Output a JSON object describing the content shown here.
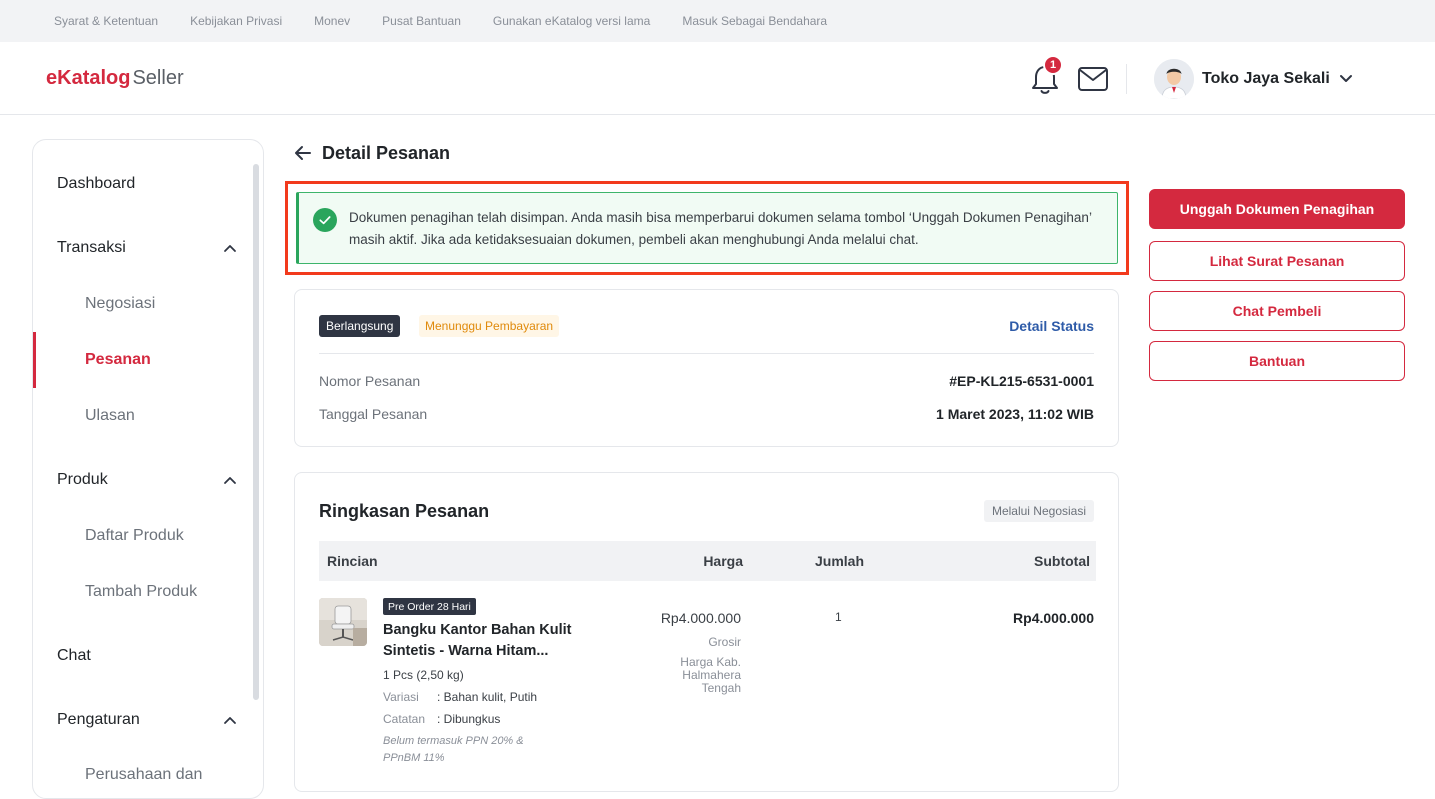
{
  "topbar": {
    "links": [
      "Syarat & Ketentuan",
      "Kebijakan Privasi",
      "Monev",
      "Pusat Bantuan",
      "Gunakan eKatalog versi lama",
      "Masuk Sebagai Bendahara"
    ]
  },
  "header": {
    "logo_main": "eKatalog",
    "logo_sub": "Seller",
    "notification_count": "1",
    "user_name": "Toko Jaya Sekali"
  },
  "sidebar": {
    "dashboard": "Dashboard",
    "transaksi": "Transaksi",
    "negosiasi": "Negosiasi",
    "pesanan": "Pesanan",
    "ulasan": "Ulasan",
    "produk": "Produk",
    "daftar_produk": "Daftar Produk",
    "tambah_produk": "Tambah Produk",
    "chat": "Chat",
    "pengaturan": "Pengaturan",
    "perusahaan": "Perusahaan dan"
  },
  "page": {
    "title": "Detail Pesanan"
  },
  "alert": {
    "text": "Dokumen penagihan telah disimpan. Anda masih bisa memperbarui dokumen selama tombol ‘Unggah Dokumen Penagihan’ masih aktif. Jika ada ketidaksesuaian dokumen, pembeli akan menghubungi Anda melalui chat."
  },
  "order": {
    "status_tag": "Berlangsung",
    "payment_tag": "Menunggu Pembayaran",
    "detail_status_link": "Detail Status",
    "number_label": "Nomor Pesanan",
    "number_value": "#EP-KL215-6531-0001",
    "date_label": "Tanggal Pesanan",
    "date_value": "1 Maret 2023, 11:02 WIB"
  },
  "summary": {
    "title": "Ringkasan Pesanan",
    "via_tag": "Melalui Negosiasi",
    "columns": {
      "rincian": "Rincian",
      "harga": "Harga",
      "jumlah": "Jumlah",
      "subtotal": "Subtotal"
    },
    "item": {
      "preorder_tag": "Pre Order 28 Hari",
      "name": "Bangku Kantor Bahan Kulit Sintetis - Warna Hitam...",
      "weight": "1 Pcs (2,50 kg)",
      "variasi_label": "Variasi",
      "variasi_value": ": Bahan kulit, Putih",
      "catatan_label": "Catatan",
      "catatan_value": ": Dibungkus",
      "tax_note": "Belum termasuk PPN 20% & PPnBM 11%",
      "price": "Rp4.000.000",
      "price_type": "Grosir",
      "price_region": "Harga Kab. Halmahera Tengah",
      "quantity": "1",
      "subtotal": "Rp4.000.000"
    }
  },
  "actions": {
    "upload": "Unggah Dokumen Penagihan",
    "view_po": "Lihat Surat Pesanan",
    "chat_buyer": "Chat Pembeli",
    "help": "Bantuan"
  },
  "colors": {
    "brand": "#d4293f",
    "success": "#2aa55c",
    "highlight": "#f23a1d",
    "link": "#2e5ba8"
  }
}
